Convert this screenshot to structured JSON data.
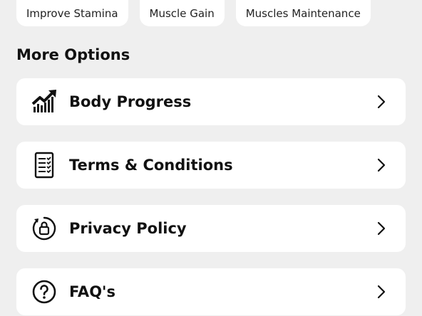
{
  "goal_chips": [
    {
      "label": "Improve Stamina"
    },
    {
      "label": "Muscle Gain"
    },
    {
      "label": "Muscles Maintenance"
    }
  ],
  "more_options": {
    "title": "More Options",
    "items": [
      {
        "label": "Body Progress",
        "icon": "chart-trending-up-icon"
      },
      {
        "label": "Terms & Conditions",
        "icon": "checklist-document-icon"
      },
      {
        "label": "Privacy Policy",
        "icon": "lock-circle-icon"
      },
      {
        "label": "FAQ's",
        "icon": "question-circle-icon"
      }
    ]
  },
  "colors": {
    "background": "#efefef",
    "card": "#ffffff",
    "text": "#111111"
  }
}
